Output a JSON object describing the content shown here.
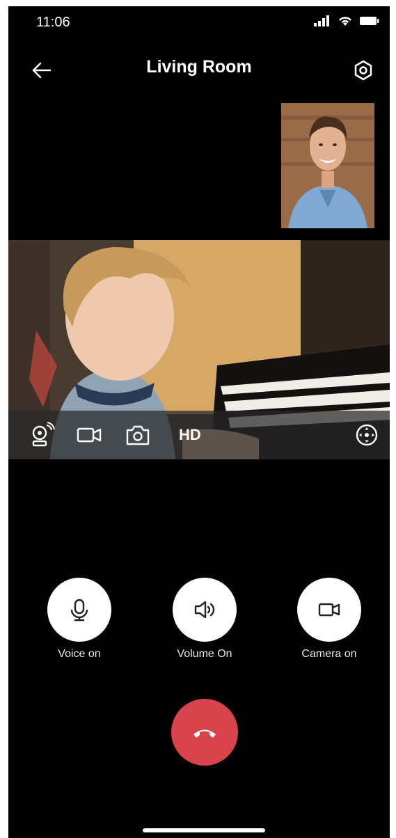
{
  "status_bar": {
    "time": "11:06"
  },
  "header": {
    "title": "Living Room"
  },
  "feed_controls": {
    "hd_label": "HD"
  },
  "actions": [
    {
      "label": "Voice on",
      "icon": "microphone-icon"
    },
    {
      "label": "Volume On",
      "icon": "speaker-icon"
    },
    {
      "label": "Camera on",
      "icon": "video-camera-icon"
    }
  ],
  "colors": {
    "background": "#000000",
    "hangup": "#d9434b",
    "button": "#ffffff"
  }
}
